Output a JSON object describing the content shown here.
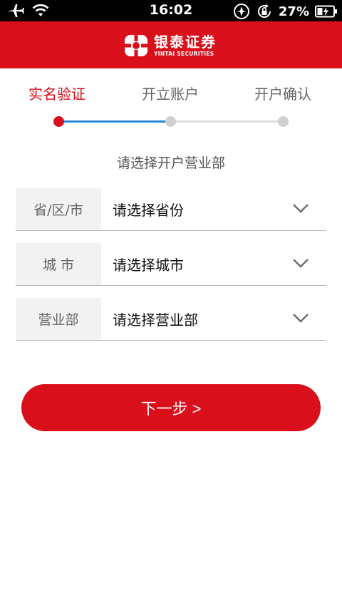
{
  "status_bar": {
    "time": "16:02",
    "battery_percent": "27%",
    "icons": [
      "airplane-icon",
      "wifi-icon",
      "location-icon",
      "rotation-lock-icon",
      "battery-charging-icon"
    ]
  },
  "header": {
    "brand_cn": "银泰证券",
    "brand_en": "YINTAI SECURITIES",
    "color": "#d90f1c"
  },
  "steps": {
    "items": [
      {
        "label": "实名验证",
        "active": true
      },
      {
        "label": "开立账户",
        "active": false
      },
      {
        "label": "开户确认",
        "active": false
      }
    ],
    "active_color": "#d90f1c",
    "track_color": "#2a88d8"
  },
  "form": {
    "title": "请选择开户营业部",
    "rows": [
      {
        "label": "省/区/市",
        "value": "请选择省份"
      },
      {
        "label": "城 市",
        "value": "请选择城市"
      },
      {
        "label": "营业部",
        "value": "请选择营业部"
      }
    ]
  },
  "actions": {
    "next_label": "下一步 >"
  }
}
